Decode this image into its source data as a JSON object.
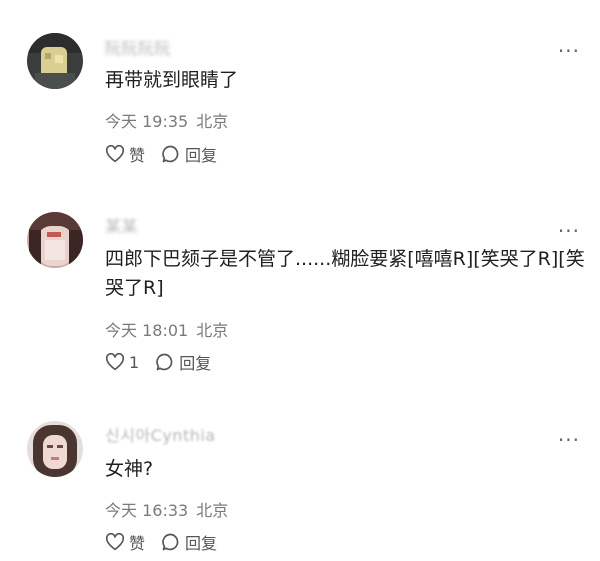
{
  "comments": [
    {
      "username": "阮阮阮阮",
      "content": "再带就到眼睛了",
      "time": "今天 19:35",
      "location": "北京",
      "like_label": "赞",
      "reply_label": "回复",
      "more_label": "···"
    },
    {
      "username": "某某",
      "content": "四郎下巴颏子是不管了......糊脸要紧[嘻嘻R][笑哭了R][笑哭了R]",
      "time": "今天 18:01",
      "location": "北京",
      "like_label": "1",
      "reply_label": "回复",
      "more_label": "···"
    },
    {
      "username": "신시아Cynthia",
      "content": "女神?",
      "time": "今天 16:33",
      "location": "北京",
      "like_label": "赞",
      "reply_label": "回复",
      "more_label": "···"
    }
  ],
  "colors": {
    "background": "#ffffff",
    "text": "#1f1f1f",
    "meta": "#7a7a7a",
    "username": "#b7b7b7"
  },
  "icons": {
    "like": "heart-outline-icon",
    "reply": "speech-bubble-icon",
    "more": "more-dots-icon"
  }
}
